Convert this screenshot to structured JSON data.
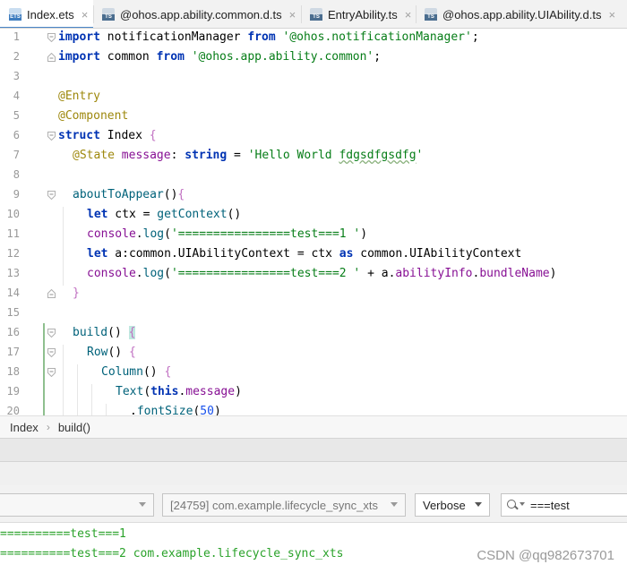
{
  "tabs": [
    {
      "label": "Index.ets",
      "badge": "ETS",
      "active": true
    },
    {
      "label": "@ohos.app.ability.common.d.ts",
      "badge": "TS",
      "active": false
    },
    {
      "label": "EntryAbility.ts",
      "badge": "TS",
      "active": false
    },
    {
      "label": "@ohos.app.ability.UIAbility.d.ts",
      "badge": "TS",
      "active": false
    }
  ],
  "close_glyph": "×",
  "code": {
    "line_numbers": [
      "1",
      "2",
      "3",
      "4",
      "5",
      "6",
      "7",
      "8",
      "9",
      "10",
      "11",
      "12",
      "13",
      "14",
      "15",
      "16",
      "17",
      "18",
      "19",
      "20"
    ],
    "l1": {
      "kw1": "import",
      "id": " notificationManager ",
      "kw2": "from",
      "str": " '@ohos.notificationManager'",
      "end": ";"
    },
    "l2": {
      "kw1": "import",
      "id": " common ",
      "kw2": "from",
      "str": " '@ohos.app.ability.common'",
      "end": ";"
    },
    "l4": {
      "ann": "@Entry"
    },
    "l5": {
      "ann": "@Component"
    },
    "l6": {
      "kw": "struct",
      "name": " Index ",
      "brace": "{"
    },
    "l7": {
      "ann": "@State",
      "prop": " message",
      "colon": ": ",
      "type": "string",
      "eq": " = ",
      "str1": "'Hello World ",
      "str2": "fdgsdfgsdfg",
      "str3": "'"
    },
    "l9": {
      "fn": "aboutToAppear",
      "paren": "()",
      "brace": "{"
    },
    "l10": {
      "kw": "let",
      "rest": " ctx = ",
      "fn": "getContext",
      "paren": "()"
    },
    "l11": {
      "obj": "console",
      "dot": ".",
      "fn": "log",
      "open": "(",
      "str": "'================test===1 '",
      "close": ")"
    },
    "l12": {
      "kw": "let",
      "var": " a",
      "colon": ":",
      "ns1": "common",
      "dot1": ".",
      "type1": "UIAbilityContext",
      "eq": " = ctx ",
      "as": "as",
      "sp": " ",
      "ns2": "common",
      "dot2": ".",
      "type2": "UIAbilityContext"
    },
    "l13": {
      "obj": "console",
      "dot": ".",
      "fn": "log",
      "open": "(",
      "str": "'================test===2 '",
      "plus": " + a.",
      "p1": "abilityInfo",
      "dot2": ".",
      "p2": "bundleName",
      "close": ")"
    },
    "l14": {
      "brace": "}"
    },
    "l16": {
      "fn": "build",
      "paren": "() ",
      "brace": "{"
    },
    "l17": {
      "fn": "Row",
      "paren": "() ",
      "brace": "{"
    },
    "l18": {
      "fn": "Column",
      "paren": "() ",
      "brace": "{"
    },
    "l19": {
      "fn": "Text",
      "open": "(",
      "kw": "this",
      "dot": ".",
      "prop": "message",
      "close": ")"
    },
    "l20": {
      "dot": ".",
      "fn": "fontSize",
      "open": "(",
      "num": "50",
      "close": ")"
    }
  },
  "breadcrumb": {
    "items": [
      "Index",
      "build()"
    ],
    "separator": "›"
  },
  "filters": {
    "process": "[24759] com.example.lifecycle_sync_xts",
    "level": "Verbose",
    "search_value": "===test"
  },
  "logs": [
    "==========test===1",
    "==========test===2 com.example.lifecycle_sync_xts"
  ],
  "watermark": "CSDN @qq982673701"
}
